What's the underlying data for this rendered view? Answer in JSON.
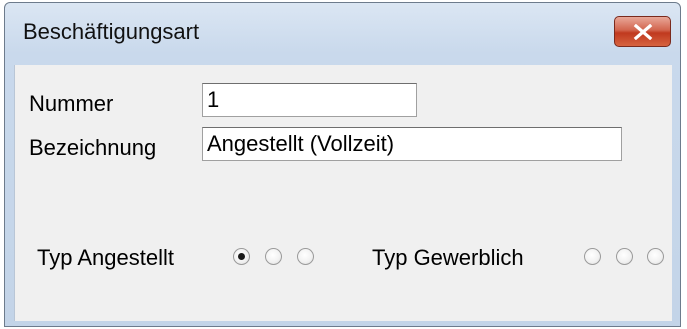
{
  "window": {
    "title": "Beschäftigungsart",
    "close_icon": "close-icon"
  },
  "form": {
    "nummer_label": "Nummer",
    "nummer_value": "1",
    "bezeichnung_label": "Bezeichnung",
    "bezeichnung_value": "Angestellt (Vollzeit)",
    "typ_angestellt_label": "Typ Angestellt",
    "typ_angestellt_options": [
      true,
      false,
      false
    ],
    "typ_gewerblich_label": "Typ Gewerblich",
    "typ_gewerblich_options": [
      false,
      false,
      false
    ]
  },
  "colors": {
    "close_button": "#c0391f",
    "title_bar": "#c9d9ec",
    "client_bg": "#f0f0f0"
  }
}
